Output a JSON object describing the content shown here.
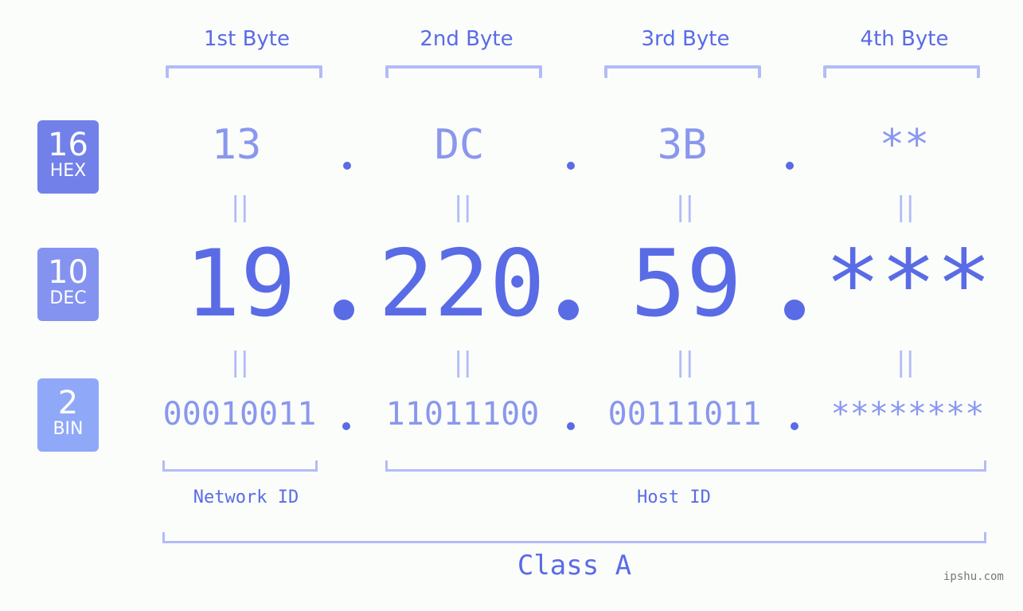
{
  "bytes": {
    "labels": [
      "1st Byte",
      "2nd Byte",
      "3rd Byte",
      "4th Byte"
    ]
  },
  "badges": {
    "hex": {
      "num": "16",
      "label": "HEX",
      "color": "#7280ea"
    },
    "dec": {
      "num": "10",
      "label": "DEC",
      "color": "#8493f0"
    },
    "bin": {
      "num": "2",
      "label": "BIN",
      "color": "#8fa8f7"
    }
  },
  "hex": [
    "13",
    "DC",
    "3B",
    "**"
  ],
  "dec": [
    "19",
    "220",
    "59",
    "***"
  ],
  "bin": [
    "00010011",
    "11011100",
    "00111011",
    "********"
  ],
  "equals_symbol": "||",
  "segments": {
    "network_label": "Network ID",
    "host_label": "Host ID"
  },
  "class_label": "Class A",
  "watermark": "ipshu.com",
  "colors": {
    "accent": "#5a6be6",
    "light_accent": "#8a97ee",
    "bracket": "#b3bcf7",
    "background": "#fbfdfb"
  }
}
